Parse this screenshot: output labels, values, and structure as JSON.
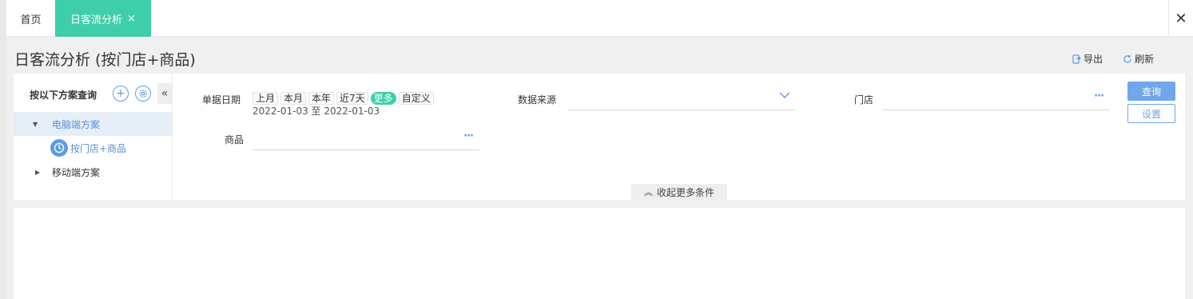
{
  "tabs": {
    "home": "首页",
    "active": "日客流分析",
    "active_close": "×",
    "close_all": "✕"
  },
  "page": {
    "title": "日客流分析 (按门店+商品)",
    "export": "导出",
    "refresh": "刷新"
  },
  "scheme": {
    "header": "按以下方案查询",
    "pc_scheme": "电脑端方案",
    "pc_sub_item": "按门店+商品",
    "mobile_scheme": "移动端方案"
  },
  "filters": {
    "date_label": "单据日期",
    "quick_dates": [
      "上月",
      "本月",
      "本年",
      "近7天",
      "更多",
      "自定义"
    ],
    "active_quick_date": "更多",
    "date_range": "2022-01-03 至 2022-01-03",
    "source_label": "数据来源",
    "source_value": "",
    "store_label": "门店",
    "store_value": "",
    "goods_label": "商品",
    "goods_value": "",
    "query_button": "查询",
    "settings_button": "设置",
    "collapse_more": "收起更多条件"
  },
  "colors": {
    "accent_teal": "#3ecfaa",
    "accent_blue": "#70a6ec"
  }
}
